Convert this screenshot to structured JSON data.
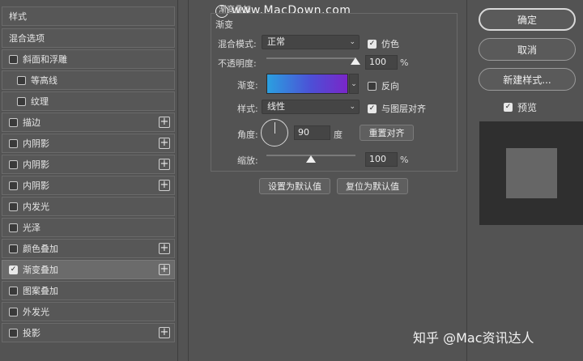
{
  "left_panel": {
    "header_styles": "样式",
    "blend_options": "混合选项",
    "items": [
      {
        "label": "斜面和浮雕",
        "checked": false,
        "indent": false,
        "plus": false
      },
      {
        "label": "等高线",
        "checked": false,
        "indent": true,
        "plus": false
      },
      {
        "label": "纹理",
        "checked": false,
        "indent": true,
        "plus": false
      },
      {
        "label": "描边",
        "checked": false,
        "indent": false,
        "plus": true
      },
      {
        "label": "内阴影",
        "checked": false,
        "indent": false,
        "plus": true
      },
      {
        "label": "内阴影",
        "checked": false,
        "indent": false,
        "plus": true
      },
      {
        "label": "内阴影",
        "checked": false,
        "indent": false,
        "plus": true
      },
      {
        "label": "内发光",
        "checked": false,
        "indent": false,
        "plus": false
      },
      {
        "label": "光泽",
        "checked": false,
        "indent": false,
        "plus": false
      },
      {
        "label": "颜色叠加",
        "checked": false,
        "indent": false,
        "plus": true
      },
      {
        "label": "渐变叠加",
        "checked": true,
        "indent": false,
        "plus": true
      },
      {
        "label": "图案叠加",
        "checked": false,
        "indent": false,
        "plus": false
      },
      {
        "label": "外发光",
        "checked": false,
        "indent": false,
        "plus": false
      },
      {
        "label": "投影",
        "checked": false,
        "indent": false,
        "plus": true
      }
    ]
  },
  "gradient_overlay": {
    "section_title": "渐变叠加",
    "group_title": "渐变",
    "blend_mode_label": "混合模式:",
    "blend_mode_value": "正常",
    "dither_label": "仿色",
    "opacity_label": "不透明度:",
    "opacity_value": "100",
    "opacity_unit": "%",
    "opacity_fraction": 1.0,
    "gradient_label": "渐变:",
    "reverse_label": "反向",
    "style_label": "样式:",
    "style_value": "线性",
    "align_label": "与图层对齐",
    "angle_label": "角度:",
    "angle_value": "90",
    "angle_unit": "度",
    "reset_align_button": "重置对齐",
    "scale_label": "缩放:",
    "scale_value": "100",
    "scale_unit": "%",
    "scale_fraction": 0.5,
    "set_default_button": "设置为默认值",
    "reset_default_button": "复位为默认值",
    "gradient_colors": [
      "#2aa0e0",
      "#4d4fd6",
      "#7a26c8"
    ]
  },
  "right_panel": {
    "ok_button": "确定",
    "cancel_button": "取消",
    "new_style_button": "新建样式...",
    "preview_label": "预览"
  },
  "watermarks": {
    "top": "www.MacDown.com",
    "bottom": "知乎 @Mac资讯达人"
  }
}
